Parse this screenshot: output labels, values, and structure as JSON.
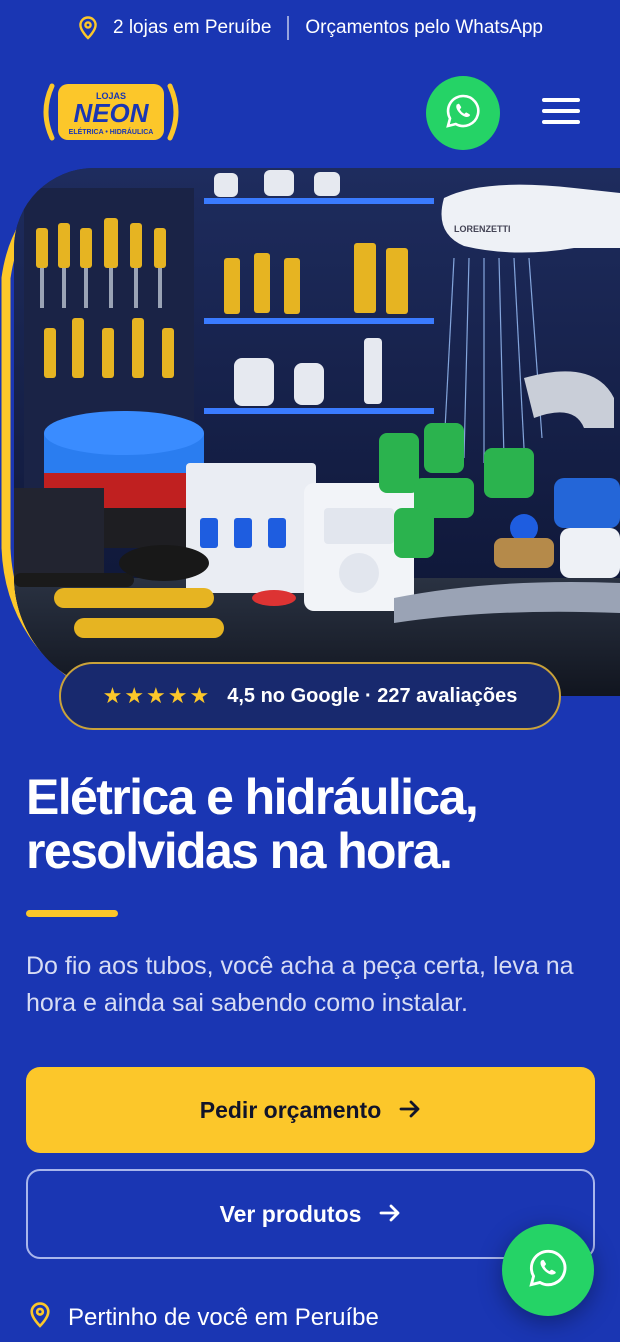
{
  "topbar": {
    "stores": "2 lojas em Peruíbe",
    "whatsapp": "Orçamentos pelo WhatsApp"
  },
  "logo": {
    "small": "LOJAS",
    "brand": "NEON",
    "tagline": "ELÉTRICA • HIDRÁULICA"
  },
  "hero": {
    "image_label": "LORENZETTI"
  },
  "rating": {
    "stars": "★★★★★",
    "text": "4,5 no Google · 227 avaliações"
  },
  "headline": {
    "line1": "Elétrica e hidráulica,",
    "line2": "resolvidas na hora."
  },
  "lede": "Do fio aos tubos, você acha a peça certa, leva na hora e ainda sai sabendo como instalar.",
  "buttons": {
    "primary": "Pedir orçamento",
    "secondary": "Ver produtos"
  },
  "footnote": "Pertinho de você em Peruíbe",
  "colors": {
    "background": "#1a36b3",
    "accent": "#fcc72a",
    "whatsapp": "#25d366"
  },
  "icons": [
    "location-pin-icon",
    "whatsapp-icon",
    "hamburger-menu-icon",
    "star-icon",
    "arrow-right-icon"
  ]
}
